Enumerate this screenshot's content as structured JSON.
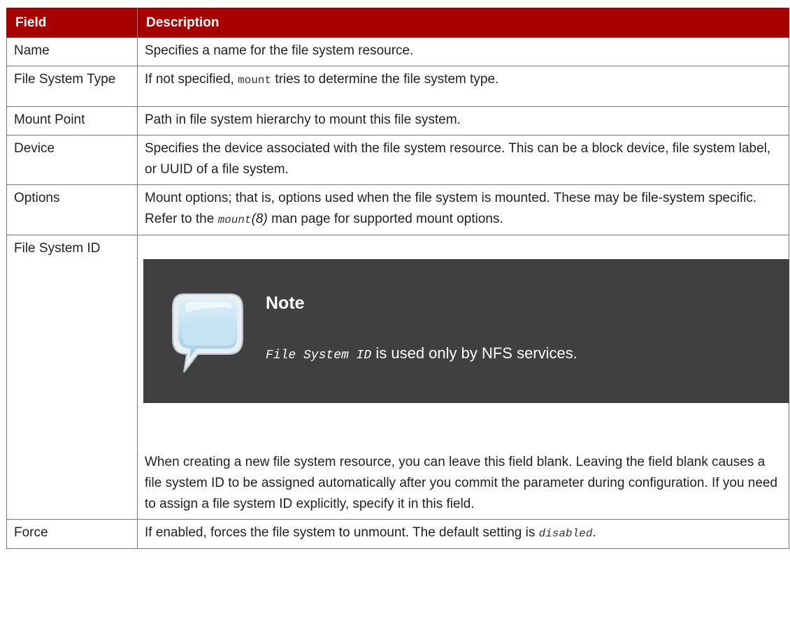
{
  "table": {
    "headers": [
      "Field",
      "Description"
    ],
    "rows": {
      "name": {
        "field": "Name",
        "desc": "Specifies a name for the file system resource."
      },
      "fstype": {
        "field": "File System Type",
        "desc_before": "If not specified, ",
        "desc_code": "mount",
        "desc_after": " tries to determine the file system type."
      },
      "mountpoint": {
        "field": "Mount Point",
        "desc": "Path in file system hierarchy to mount this file system."
      },
      "device": {
        "field": "Device",
        "desc": "Specifies the device associated with the file system resource. This can be a block device, file system label, or UUID of a file system."
      },
      "options": {
        "field": "Options",
        "desc_before": "Mount options; that is, options used when the file system is mounted. These may be file-system specific. Refer to the ",
        "desc_code": "mount",
        "desc_manref": "(8)",
        "desc_after": " man page for supported mount options."
      },
      "fsid": {
        "field": "File System ID",
        "note": {
          "icon": "speech-bubble-icon",
          "title": "Note",
          "body_code": "File System ID",
          "body_after": " is used only by NFS services."
        },
        "desc": "When creating a new file system resource, you can leave this field blank. Leaving the field blank causes a file system ID to be assigned automatically after you commit the parameter during configuration. If you need to assign a file system ID explicitly, specify it in this field."
      },
      "force": {
        "field": "Force",
        "desc_before": "If enabled, forces the file system to unmount. The default setting is ",
        "desc_code": "disabled",
        "desc_after": "."
      }
    }
  },
  "colors": {
    "header_bg": "#a70000",
    "header_text": "#ffffff",
    "note_bg": "#404040",
    "border": "#777777"
  }
}
